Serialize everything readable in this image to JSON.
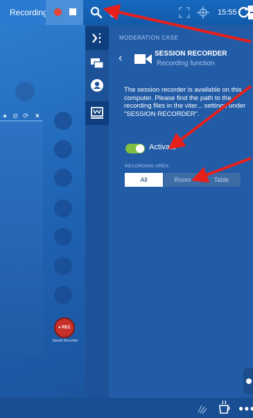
{
  "topbar": {
    "recording_label": "Recording",
    "time": "15:55"
  },
  "workspace": {
    "recorder_app_badge": "● REC",
    "recorder_app_label": "Sessie Recorder"
  },
  "panel": {
    "section_title": "MODERATION CASE",
    "header_title": "SESSION RECORDER",
    "header_subtitle": "Recording function",
    "description": "The session recorder is available on this computer. Please find the path to the recording files in the viter... settings under \"SESSION RECORDER\".",
    "activate_label": "Activate",
    "activate_state": true,
    "recording_area_label": "RECORDING AREA:",
    "recording_area_options": [
      "All",
      "Room",
      "Table"
    ],
    "recording_area_selected": "All"
  },
  "colors": {
    "accent": "#2a7bd1",
    "toggle_on": "#7fc043",
    "record_red": "#e6463b",
    "annotation_arrow": "#e8201c"
  },
  "icons": {
    "topbar": [
      "record-dot-icon",
      "stop-icon",
      "search-icon",
      "status-dot-icon",
      "fullscreen-icon",
      "crosshair-icon",
      "reload-icon",
      "exit-icon"
    ],
    "sidebar": [
      "collapse-panel-icon",
      "chat-icon",
      "user-icon",
      "moderator-icon"
    ],
    "bottombar": [
      "raise-hand-icon",
      "coffee-cup-icon",
      "more-icon"
    ]
  }
}
